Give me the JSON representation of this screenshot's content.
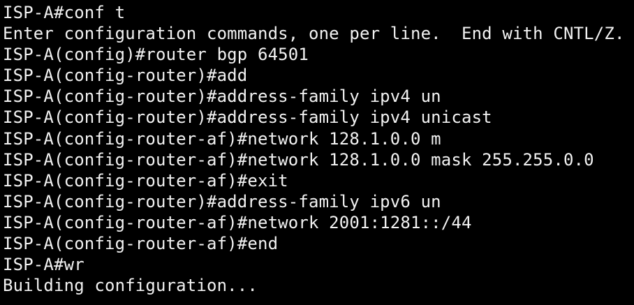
{
  "terminal": {
    "lines": [
      "ISP-A#conf t",
      "Enter configuration commands, one per line.  End with CNTL/Z.",
      "ISP-A(config)#router bgp 64501",
      "ISP-A(config-router)#add",
      "ISP-A(config-router)#address-family ipv4 un",
      "ISP-A(config-router)#address-family ipv4 unicast",
      "ISP-A(config-router-af)#network 128.1.0.0 m",
      "ISP-A(config-router-af)#network 128.1.0.0 mask 255.255.0.0",
      "ISP-A(config-router-af)#exit",
      "ISP-A(config-router)#address-family ipv6 un",
      "ISP-A(config-router-af)#network 2001:1281::/44",
      "ISP-A(config-router-af)#end",
      "ISP-A#wr",
      "Building configuration..."
    ]
  },
  "colors": {
    "background": "#000000",
    "text": "#f2f2f2"
  }
}
